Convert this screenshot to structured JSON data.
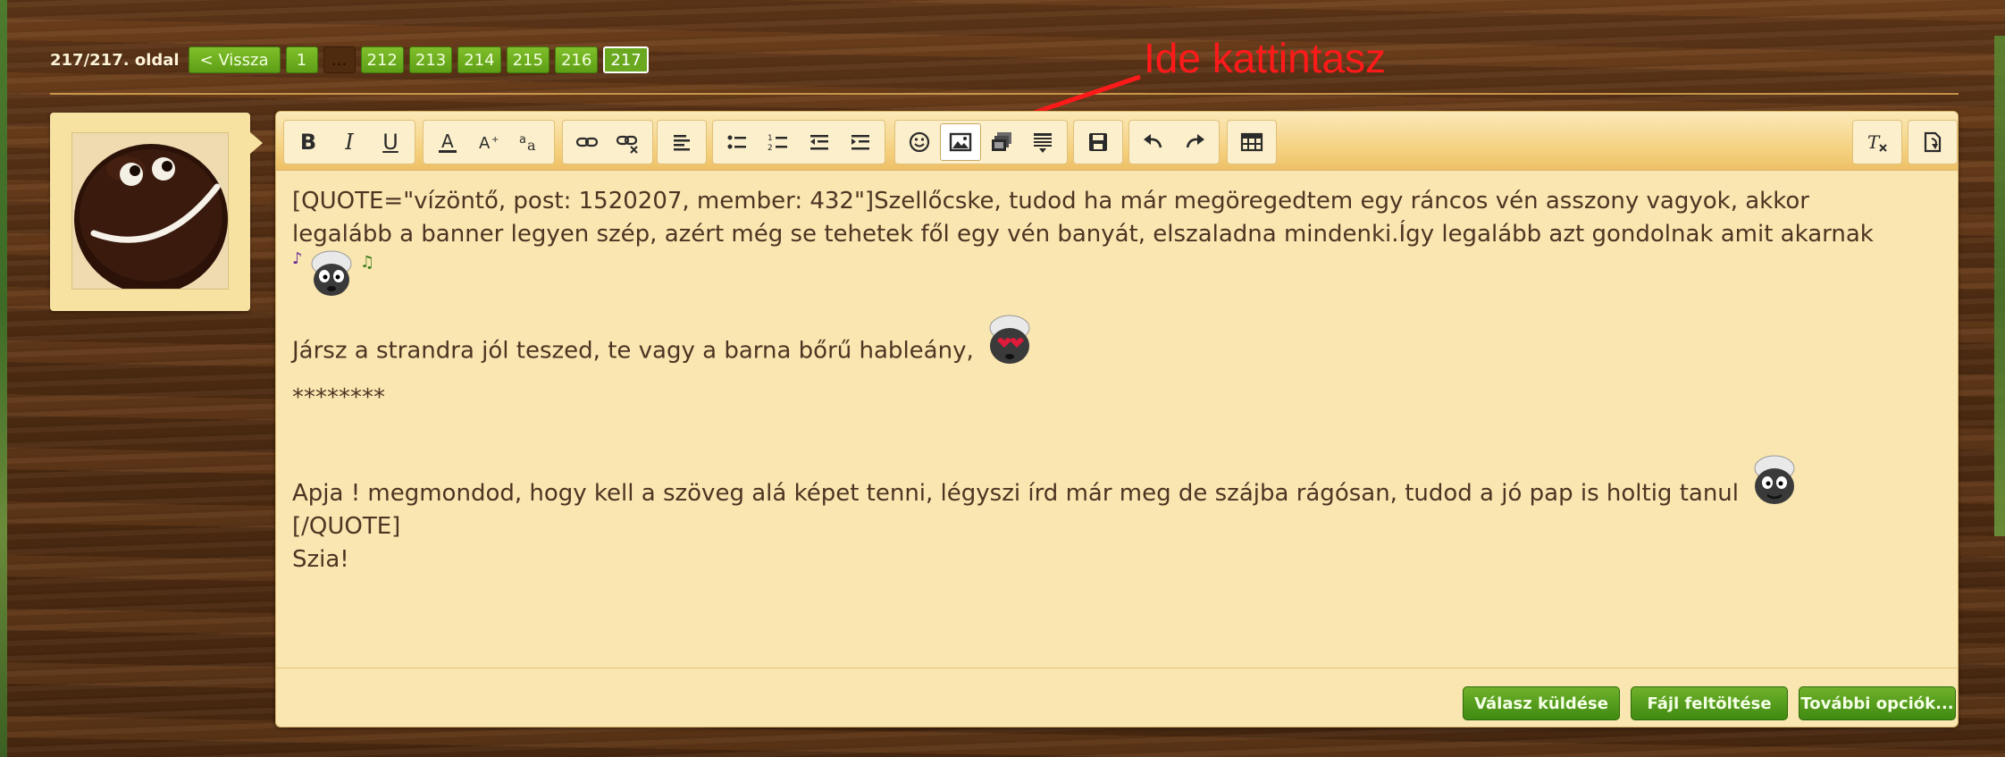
{
  "pagination": {
    "label": "217/217. oldal",
    "back_label": "< Vissza",
    "pages": [
      "1",
      "…",
      "212",
      "213",
      "214",
      "215",
      "216",
      "217"
    ],
    "current_page": "217"
  },
  "annotation": {
    "text": "Ide kattintasz",
    "color": "#ff1a1a"
  },
  "toolbar": {
    "buttons": [
      "bold",
      "italic",
      "underline",
      "text-color",
      "font-size",
      "font-family",
      "link",
      "unlink",
      "align",
      "bullet-list",
      "numbered-list",
      "outdent",
      "indent",
      "smilies",
      "image",
      "media",
      "quote",
      "save-draft",
      "undo",
      "redo",
      "table",
      "remove-format",
      "toggle-bbcode"
    ],
    "bold_label": "B",
    "italic_label": "I",
    "underline_label": "U",
    "highlighted_button": "image"
  },
  "content": {
    "line1": "[QUOTE=\"vízöntő, post: 1520207, member: 432\"]Szellőcske, tudod ha már megöregedtem egy ráncos vén asszony vagyok, akkor",
    "line2": "legalább a banner legyen szép, azért még se tehetek fől egy vén banyát, elszaladna mindenki.Így legalább azt gondolnak amit akarnak",
    "line3": "Jársz a strandra jól teszed, te vagy a barna bőrű hableány,",
    "line4": "********",
    "line5": "Apja ! megmondod, hogy kell a szöveg alá képet tenni, légyszi írd már meg de szájba rágósan, tudod a jó pap is holtig tanul",
    "line6": "[/QUOTE]",
    "line7": "Szia!"
  },
  "actions": {
    "send_label": "Válasz küldése",
    "upload_label": "Fájl feltöltése",
    "more_label": "További opciók..."
  },
  "colors": {
    "accent_green": "#5e9e16",
    "editor_bg": "#f9e6b0",
    "text": "#4b3523"
  }
}
